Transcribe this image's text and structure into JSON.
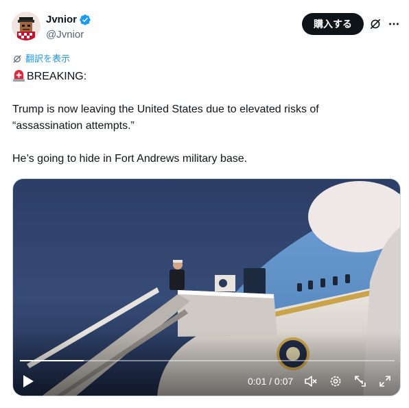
{
  "author": {
    "display_name": "Jvnior",
    "handle": "@Jvnior",
    "avatar_icon": "pixel-art-avatar",
    "verified_icon": "verified-badge-icon",
    "verified_color": "#1d9bf0"
  },
  "header": {
    "buy_label": "購入する",
    "grok_icon": "grok-icon",
    "more_icon": "more-dots-icon"
  },
  "translate": {
    "label": "翻訳を表示",
    "icon": "translate-icon",
    "color": "#1d9bf0"
  },
  "tweet": {
    "siren_icon": "rotating-light-emoji",
    "line1": "BREAKING:",
    "line2": "Trump is now leaving the United States due to elevated risks of",
    "line3": "“assassination attempts.”",
    "line4": "He’s going to hide in Fort Andrews military base."
  },
  "video": {
    "current_time": "0:01",
    "separator": " / ",
    "duration": "0:07",
    "progress_fraction": 0.17,
    "icons": [
      "play-icon",
      "mute-icon",
      "settings-icon",
      "pip-icon",
      "fullscreen-icon"
    ]
  },
  "colors": {
    "text_primary": "#0f1419",
    "text_secondary": "#536471",
    "button_dark": "#0f1419"
  }
}
